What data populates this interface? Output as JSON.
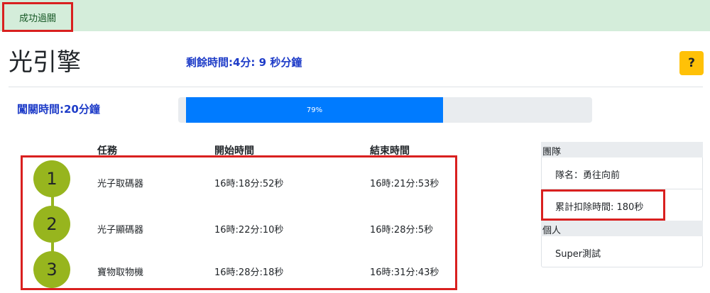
{
  "banner": {
    "label": "成功過關"
  },
  "header": {
    "title": "光引擎",
    "remaining_time": "剩餘時間:4分: 9 秒分鐘",
    "help_label": "?"
  },
  "level": {
    "time_label": "闖關時間:20分鐘",
    "progress_text": "79%",
    "progress_value": 0.79
  },
  "tasks": {
    "headers": {
      "task": "任務",
      "start": "開始時間",
      "end": "結束時間"
    },
    "rows": [
      {
        "step": "1",
        "name": "光子取碼器",
        "start": "16時:18分:52秒",
        "end": "16時:21分:53秒"
      },
      {
        "step": "2",
        "name": "光子顯碼器",
        "start": "16時:22分:10秒",
        "end": "16時:28分:5秒"
      },
      {
        "step": "3",
        "name": "寶物取物機",
        "start": "16時:28分:18秒",
        "end": "16時:31分:43秒"
      }
    ]
  },
  "team": {
    "header": "團隊",
    "name": "隊名：勇往向前",
    "deduct": "累計扣除時間: 180秒"
  },
  "personal": {
    "header": "個人",
    "name": "Super測試"
  },
  "colors": {
    "banner_bg": "#d4edda",
    "accent_blue": "#1e3cc8",
    "progress_blue": "#007bff",
    "step_green": "#97b51e",
    "help_yellow": "#ffc107",
    "highlight_red": "#d9201f"
  }
}
